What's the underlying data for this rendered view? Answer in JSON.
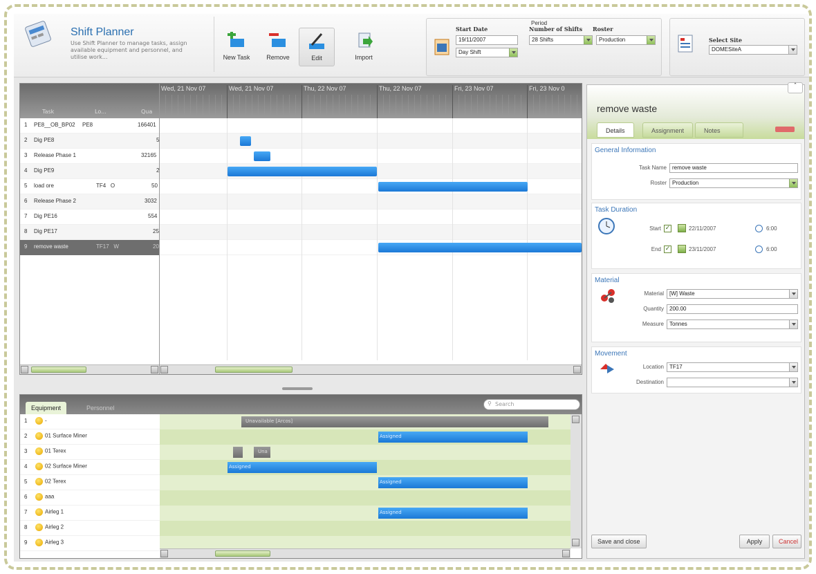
{
  "app": {
    "title": "Shift Planner",
    "description": "Use Shift Planner to manage tasks, assign available equipment and personnel, and utilise work..."
  },
  "toolbar": {
    "new_task": "New Task",
    "remove": "Remove",
    "edit": "Edit",
    "import": "Import"
  },
  "period": {
    "group_label": "Period",
    "start_date_label": "Start Date",
    "start_date": "19/11/2007",
    "shift": "Day Shift",
    "num_shifts_label": "Number of Shifts",
    "num_shifts": "28 Shifts",
    "roster_label": "Roster",
    "roster": "Production"
  },
  "site": {
    "label": "Select Site",
    "value": "DOMESiteA"
  },
  "gantt": {
    "col_task": "Task",
    "col_lo": "Lo...",
    "col_qu": "Qua",
    "dates": [
      "Wed, 21 Nov 07",
      "Wed, 21 Nov 07",
      "Thu, 22 Nov 07",
      "Thu, 22 Nov 07",
      "Fri, 23 Nov 07",
      "Fri, 23 Nov 0"
    ],
    "rows": [
      {
        "n": "1",
        "task": "PE8__OB_BP02",
        "lo": "PE8",
        "qty": "166401"
      },
      {
        "n": "2",
        "task": "Dig PE8",
        "lo": "",
        "qty": "5"
      },
      {
        "n": "3",
        "task": "Release Phase 1",
        "lo": "",
        "qty": "32165"
      },
      {
        "n": "4",
        "task": "Dig PE9",
        "lo": "",
        "qty": "2"
      },
      {
        "n": "5",
        "task": "load ore",
        "lo": "TF4   O",
        "qty": "50"
      },
      {
        "n": "6",
        "task": "Release Phase 2",
        "lo": "",
        "qty": "3032"
      },
      {
        "n": "7",
        "task": "Dig PE16",
        "lo": "",
        "qty": "554"
      },
      {
        "n": "8",
        "task": "Dig PE17",
        "lo": "",
        "qty": "25"
      },
      {
        "n": "9",
        "task": "remove waste",
        "lo": "TF17   W",
        "qty": "20"
      }
    ]
  },
  "resources": {
    "tab_equipment": "Equipment",
    "tab_personnel": "Personnel",
    "search_placeholder": "Search",
    "rows": [
      {
        "n": "1",
        "name": "-"
      },
      {
        "n": "2",
        "name": "01 Surface Miner"
      },
      {
        "n": "3",
        "name": "01 Terex"
      },
      {
        "n": "4",
        "name": "02 Surface Miner"
      },
      {
        "n": "5",
        "name": "02 Terex"
      },
      {
        "n": "6",
        "name": "aaa"
      },
      {
        "n": "7",
        "name": "Airleg 1"
      },
      {
        "n": "8",
        "name": "Airleg 2"
      },
      {
        "n": "9",
        "name": "Airleg 3"
      }
    ],
    "unavailable": "Unavailable [Arcos]",
    "assigned": "Assigned",
    "unav_short": "Una"
  },
  "panel": {
    "title": "remove waste",
    "tabs": [
      "Details",
      "Assignment",
      "Notes"
    ],
    "general": "General Information",
    "task_name_label": "Task Name",
    "task_name": "remove waste",
    "roster_label": "Roster",
    "roster": "Production",
    "duration": "Task Duration",
    "start_label": "Start",
    "start_date": "22/11/2007",
    "start_time": "6:00",
    "end_label": "End",
    "end_date": "23/11/2007",
    "end_time": "6:00",
    "material_section": "Material",
    "material_label": "Material",
    "material": "[W] Waste",
    "quantity_label": "Quantity",
    "quantity": "200.00",
    "measure_label": "Measure",
    "measure": "Tonnes",
    "movement": "Movement",
    "location_label": "Location",
    "location": "TF17",
    "destination_label": "Destination",
    "destination": "",
    "save_close": "Save and close",
    "apply": "Apply",
    "cancel": "Cancel"
  },
  "colors": {
    "accent": "#2a6fb0",
    "bar": "#1b78d6",
    "green": "#c8dc9c"
  }
}
